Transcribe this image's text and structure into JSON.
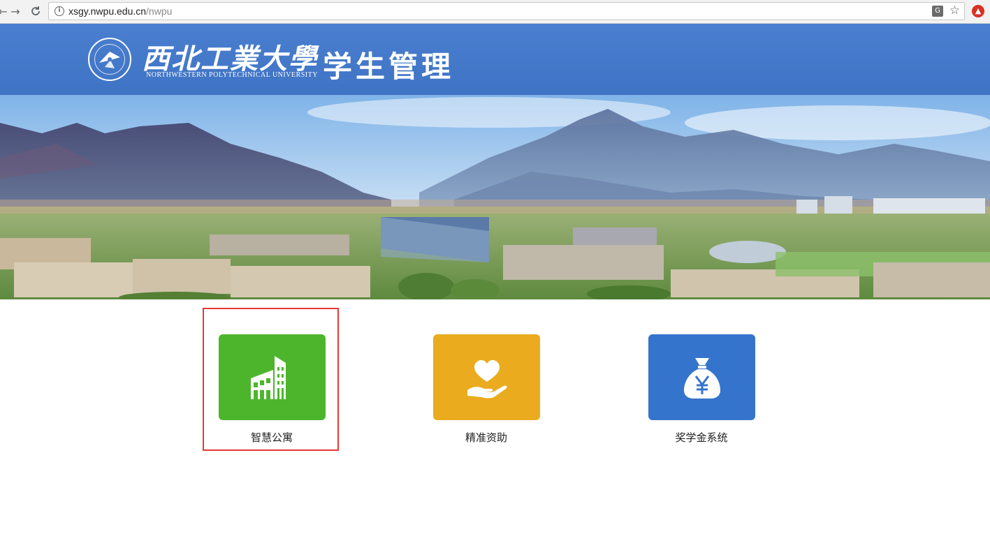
{
  "browser": {
    "url_host": "xsgy.nwpu.edu.cn",
    "url_path": "/nwpu"
  },
  "header": {
    "university_name_cn": "西北工業大學",
    "university_name_en": "NORTHWESTERN POLYTECHNICAL UNIVERSITY",
    "site_title": "学生管理",
    "color": "#4579cb"
  },
  "tiles": [
    {
      "label": "智慧公寓",
      "color": "#4db52c",
      "icon": "building-icon",
      "highlighted": true
    },
    {
      "label": "精准资助",
      "color": "#eaab1f",
      "icon": "heart-hand-icon",
      "highlighted": false
    },
    {
      "label": "奖学金系统",
      "color": "#3574cc",
      "icon": "money-bag-yen-icon",
      "highlighted": false
    }
  ]
}
